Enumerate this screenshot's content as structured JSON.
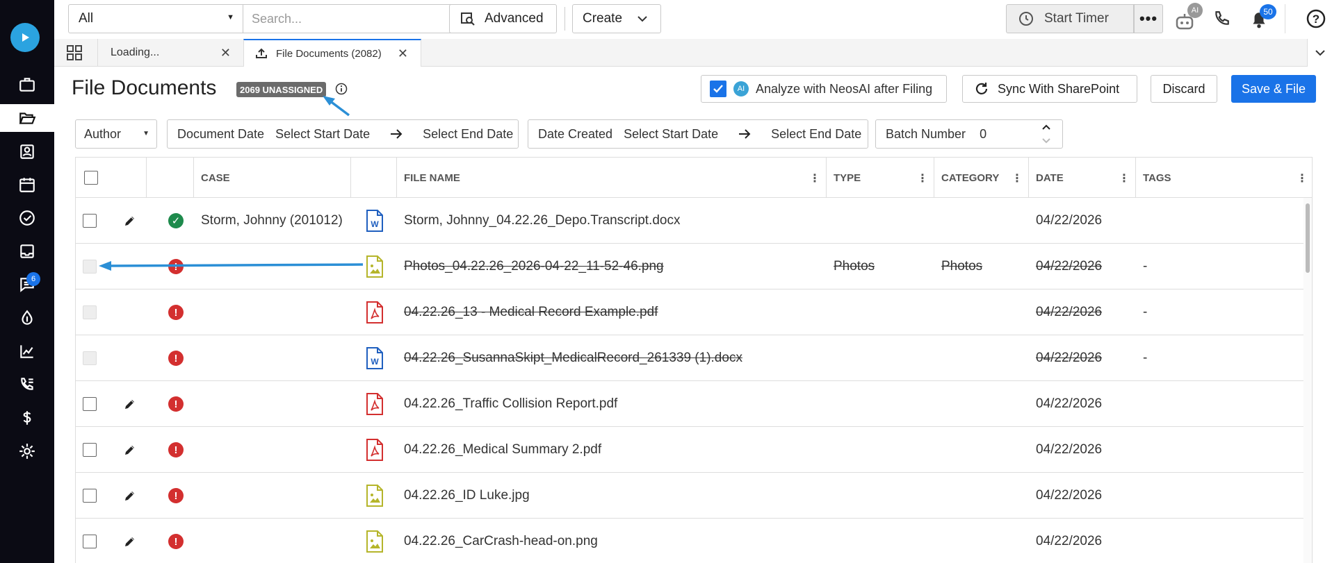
{
  "topbar": {
    "filter_select": "All",
    "search_placeholder": "Search...",
    "advanced_label": "Advanced",
    "create_label": "Create",
    "start_timer_label": "Start Timer",
    "ai_badge": "AI",
    "notifications_count": "50"
  },
  "tabs": [
    {
      "label": "Loading..."
    },
    {
      "label": "File Documents (2082)"
    }
  ],
  "sidebar": {
    "messages_badge": "6",
    "items": [
      "play-logo",
      "briefcase-icon",
      "folder-open-icon",
      "contacts-icon",
      "calendar-icon",
      "check-circle-icon",
      "inbox-icon",
      "chat-icon",
      "drop-icon",
      "chart-icon",
      "phone-list-icon",
      "dollar-icon",
      "gear-icon"
    ]
  },
  "header": {
    "title": "File Documents",
    "unassigned_badge": "2069 UNASSIGNED",
    "analyze_label": "Analyze with NeosAI after Filing",
    "analyze_ai": "AI",
    "analyze_checked": true,
    "sync_label": "Sync With SharePoint",
    "discard_label": "Discard",
    "save_label": "Save & File"
  },
  "filters": {
    "author_label": "Author",
    "doc_date_label": "Document Date",
    "doc_start": "Select Start Date",
    "doc_end": "Select End Date",
    "created_label": "Date Created",
    "created_start": "Select Start Date",
    "created_end": "Select End Date",
    "batch_label": "Batch Number",
    "batch_value": "0"
  },
  "grid": {
    "columns": [
      "CASE",
      "FILE NAME",
      "TYPE",
      "CATEGORY",
      "DATE",
      "TAGS"
    ],
    "rows": [
      {
        "editable": true,
        "disabled": false,
        "status": "ok",
        "case": "Storm, Johnny (201012)",
        "file_type": "word",
        "file_name": "Storm, Johnny_04.22.26_Depo.Transcript.docx",
        "type": "",
        "category": "",
        "date": "04/22/2026",
        "tags": "",
        "struck": false
      },
      {
        "editable": false,
        "disabled": true,
        "status": "error",
        "case": "",
        "file_type": "image",
        "file_name": "Photos_04.22.26_2026-04-22_11-52-46.png",
        "type": "Photos",
        "category": "Photos",
        "date": "04/22/2026",
        "tags": "-",
        "struck": true
      },
      {
        "editable": false,
        "disabled": true,
        "status": "error",
        "case": "",
        "file_type": "pdf",
        "file_name": "04.22.26_13 - Medical Record Example.pdf",
        "type": "",
        "category": "",
        "date": "04/22/2026",
        "tags": "-",
        "struck": true
      },
      {
        "editable": false,
        "disabled": true,
        "status": "error",
        "case": "",
        "file_type": "word",
        "file_name": "04.22.26_SusannaSkipt_MedicalRecord_261339 (1).docx",
        "type": "",
        "category": "",
        "date": "04/22/2026",
        "tags": "-",
        "struck": true
      },
      {
        "editable": true,
        "disabled": false,
        "status": "error",
        "case": "",
        "file_type": "pdf",
        "file_name": "04.22.26_Traffic Collision Report.pdf",
        "type": "",
        "category": "",
        "date": "04/22/2026",
        "tags": "",
        "struck": false
      },
      {
        "editable": true,
        "disabled": false,
        "status": "error",
        "case": "",
        "file_type": "pdf",
        "file_name": "04.22.26_Medical Summary 2.pdf",
        "type": "",
        "category": "",
        "date": "04/22/2026",
        "tags": "",
        "struck": false
      },
      {
        "editable": true,
        "disabled": false,
        "status": "error",
        "case": "",
        "file_type": "image",
        "file_name": "04.22.26_ID Luke.jpg",
        "type": "",
        "category": "",
        "date": "04/22/2026",
        "tags": "",
        "struck": false
      },
      {
        "editable": true,
        "disabled": false,
        "status": "error",
        "case": "",
        "file_type": "image",
        "file_name": "04.22.26_CarCrash-head-on.png",
        "type": "",
        "category": "",
        "date": "04/22/2026",
        "tags": "",
        "struck": false
      }
    ]
  },
  "colors": {
    "accent": "#1a73e8",
    "sidebar": "#0b0b14",
    "error": "#d32f2f",
    "ok": "#1e8a4c",
    "word": "#1f5fbf",
    "pdf": "#d32f2f",
    "image": "#b5b52a",
    "annotation": "#2b8fd6"
  }
}
